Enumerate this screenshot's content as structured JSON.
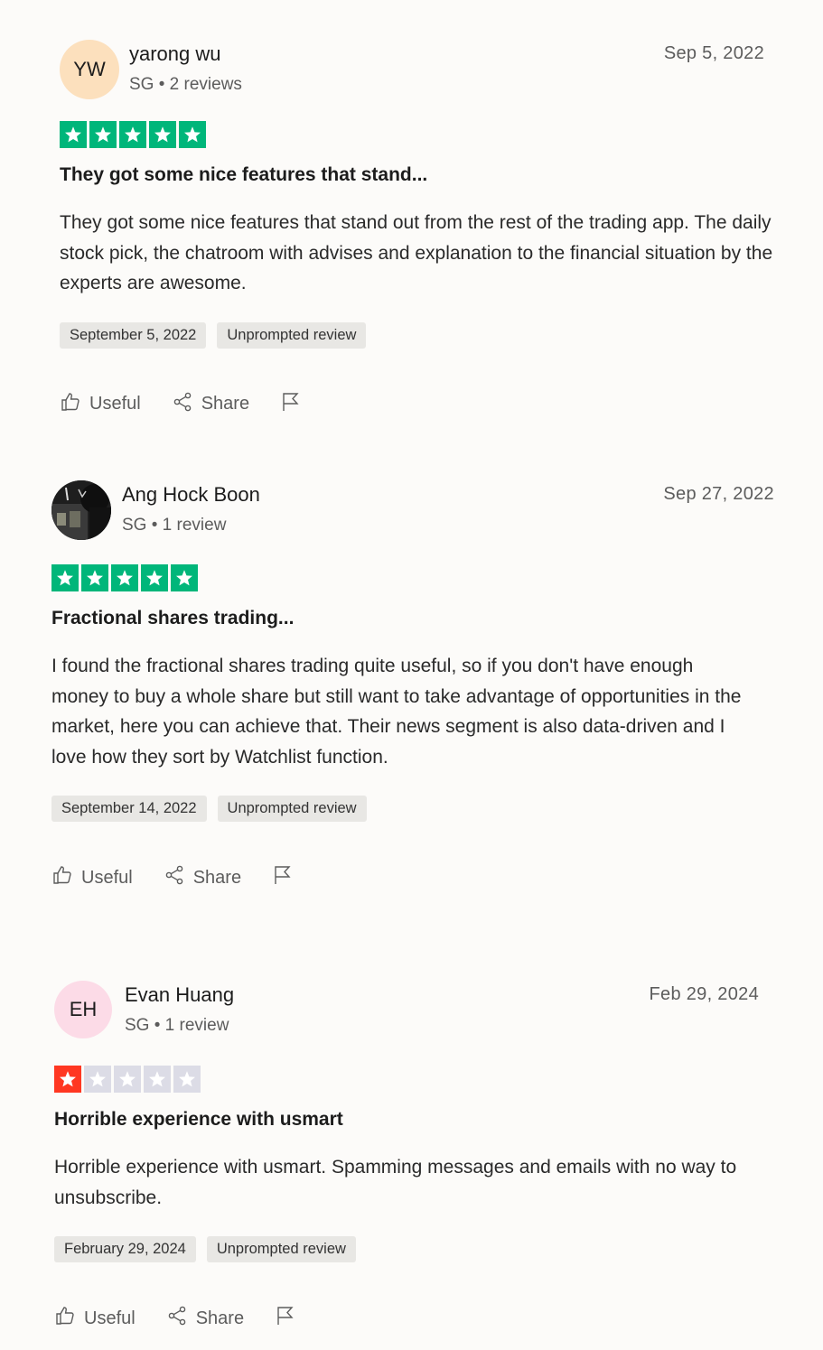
{
  "colors": {
    "star_green": "#00b67a",
    "star_red": "#ff3722",
    "star_empty": "#dcdce6",
    "avatar_yw": "#fce0bd",
    "avatar_eh": "#fcdbe7"
  },
  "reviews": [
    {
      "initials": "YW",
      "name": "yarong wu",
      "meta": "SG • 2 reviews",
      "date": "Sep 5, 2022",
      "rating": 5,
      "title": "They got some nice features that stand...",
      "body": "They got some nice features that stand out from the rest of the trading app. The daily stock pick, the chatroom with advises and explanation to the financial situation by the experts are awesome.",
      "experience_date": "September 5, 2022",
      "tag": "Unprompted review",
      "useful_label": "Useful",
      "share_label": "Share"
    },
    {
      "initials": "",
      "name": "Ang Hock Boon",
      "meta": "SG • 1 review",
      "date": "Sep 27, 2022",
      "rating": 5,
      "title": "Fractional shares trading...",
      "body": "I found the fractional shares trading quite useful, so if you don't have enough money to buy a whole share but still want to take advantage of opportunities in the market, here you can achieve that. Their news segment is also data-driven and I love how they sort by Watchlist function.",
      "experience_date": "September 14, 2022",
      "tag": "Unprompted review",
      "useful_label": "Useful",
      "share_label": "Share"
    },
    {
      "initials": "EH",
      "name": "Evan Huang",
      "meta": "SG • 1 review",
      "date": "Feb 29, 2024",
      "rating": 1,
      "title": "Horrible experience with usmart",
      "body": "Horrible experience with usmart. Spamming messages and emails with no way to unsubscribe.",
      "experience_date": "February 29, 2024",
      "tag": "Unprompted review",
      "useful_label": "Useful",
      "share_label": "Share"
    }
  ]
}
